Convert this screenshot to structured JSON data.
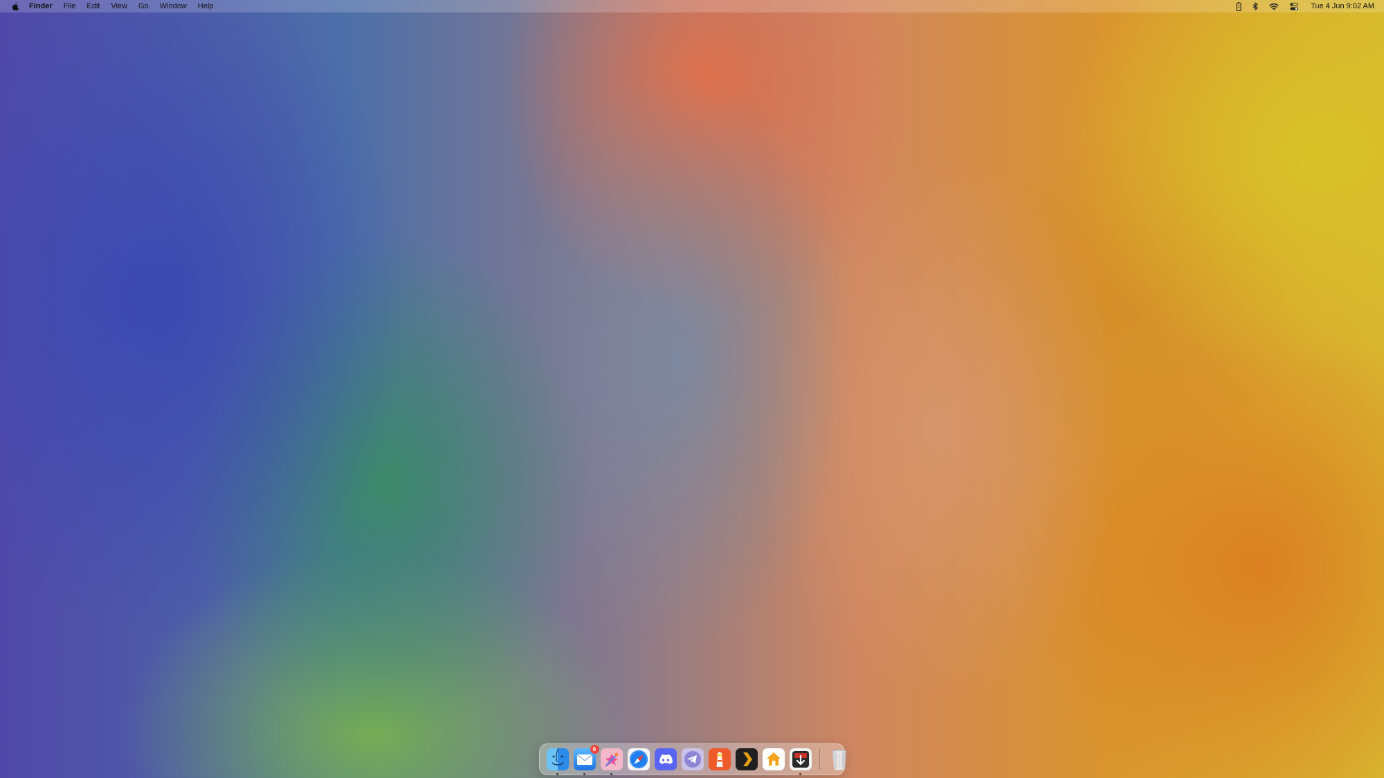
{
  "menubar": {
    "app_name": "Finder",
    "menus": [
      "File",
      "Edit",
      "View",
      "Go",
      "Window",
      "Help"
    ],
    "status_icons": [
      "battery-icon",
      "bluetooth-icon",
      "wifi-icon",
      "control-center-icon"
    ],
    "clock": "Tue 4 Jun  9:02 AM"
  },
  "dock": {
    "apps": [
      {
        "name": "Finder",
        "icon": "finder-icon",
        "running": true
      },
      {
        "name": "Mail",
        "icon": "mail-icon",
        "running": true,
        "badge": "6"
      },
      {
        "name": "Pixelmator",
        "icon": "pixelmator-icon",
        "running": true
      },
      {
        "name": "Safari",
        "icon": "safari-icon",
        "running": false
      },
      {
        "name": "Discord",
        "icon": "discord-icon",
        "running": false
      },
      {
        "name": "Telegram",
        "icon": "telegram-icon",
        "running": false
      },
      {
        "name": "Tot",
        "icon": "lighthouse-icon",
        "running": false
      },
      {
        "name": "Plex",
        "icon": "plex-icon",
        "running": false
      },
      {
        "name": "Home",
        "icon": "home-icon",
        "running": false
      },
      {
        "name": "Downloader",
        "icon": "downloader-icon",
        "running": true
      }
    ],
    "trash": {
      "name": "Trash",
      "icon": "trash-icon"
    }
  },
  "colors": {
    "badge": "#f0443a",
    "finder_blue": "#2c8ae8",
    "safari_blue": "#1c7ef0",
    "discord_purple": "#5865f2",
    "telegram_blue": "#37aee2",
    "plex_yellow": "#e5a00d"
  }
}
